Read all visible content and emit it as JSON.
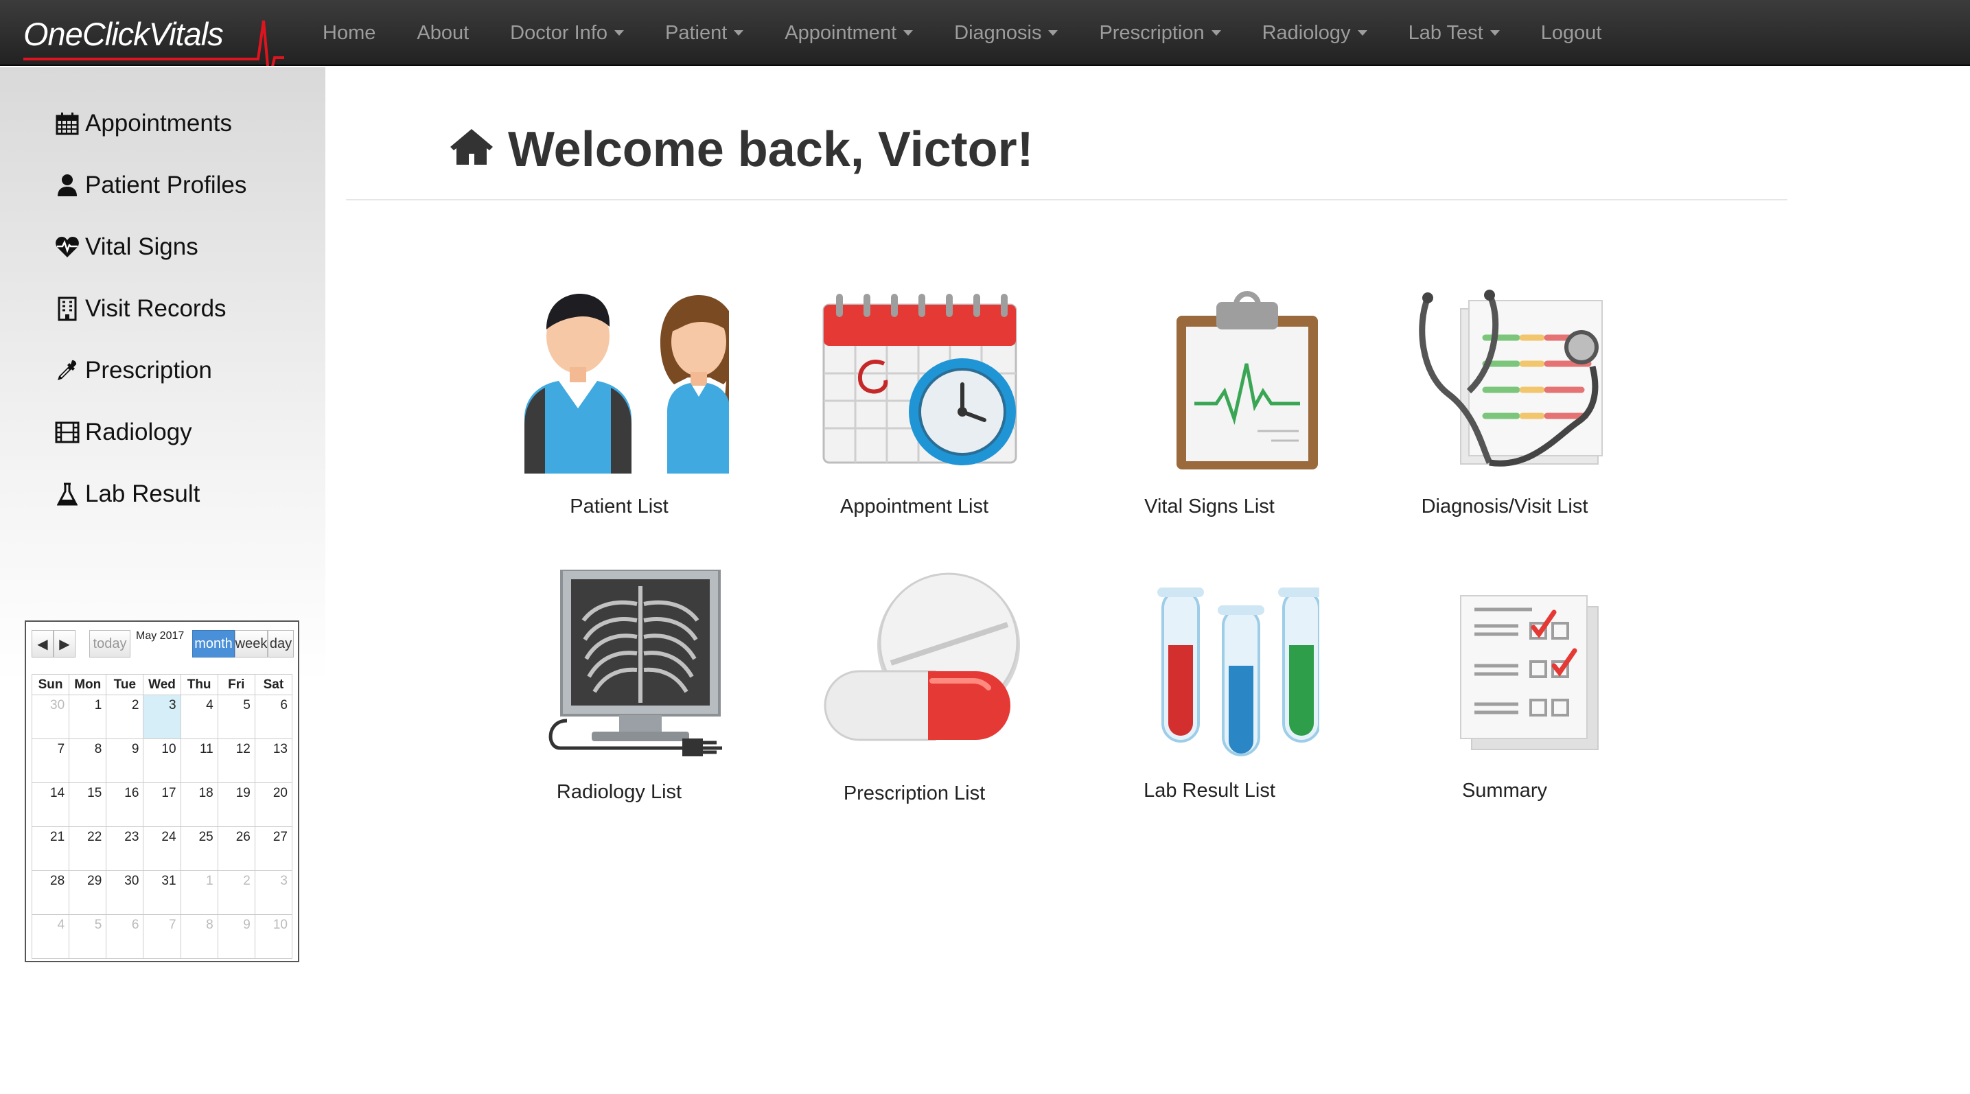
{
  "brand": {
    "name": "OneClickVitals"
  },
  "nav": [
    {
      "label": "Home",
      "dropdown": false
    },
    {
      "label": "About",
      "dropdown": false
    },
    {
      "label": "Doctor Info",
      "dropdown": true
    },
    {
      "label": "Patient",
      "dropdown": true
    },
    {
      "label": "Appointment",
      "dropdown": true
    },
    {
      "label": "Diagnosis",
      "dropdown": true
    },
    {
      "label": "Prescription",
      "dropdown": true
    },
    {
      "label": "Radiology",
      "dropdown": true
    },
    {
      "label": "Lab Test",
      "dropdown": true
    },
    {
      "label": "Logout",
      "dropdown": false
    }
  ],
  "sidebar": {
    "items": [
      {
        "label": "Appointments",
        "icon": "calendar-icon"
      },
      {
        "label": "Patient Profiles",
        "icon": "user-icon"
      },
      {
        "label": "Vital Signs",
        "icon": "heartbeat-icon"
      },
      {
        "label": "Visit Records",
        "icon": "building-icon"
      },
      {
        "label": "Prescription",
        "icon": "eyedropper-icon"
      },
      {
        "label": "Radiology",
        "icon": "film-icon"
      },
      {
        "label": "Lab Result",
        "icon": "flask-icon"
      }
    ]
  },
  "calendar": {
    "prev": "◀",
    "next": "▶",
    "today": "today",
    "title": "May 2017",
    "views": [
      "month",
      "week",
      "day"
    ],
    "active_view": "month",
    "weekdays": [
      "Sun",
      "Mon",
      "Tue",
      "Wed",
      "Thu",
      "Fri",
      "Sat"
    ],
    "weeks": [
      [
        "30",
        "1",
        "2",
        "3",
        "4",
        "5",
        "6"
      ],
      [
        "7",
        "8",
        "9",
        "10",
        "11",
        "12",
        "13"
      ],
      [
        "14",
        "15",
        "16",
        "17",
        "18",
        "19",
        "20"
      ],
      [
        "21",
        "22",
        "23",
        "24",
        "25",
        "26",
        "27"
      ],
      [
        "28",
        "29",
        "30",
        "31",
        "1",
        "2",
        "3"
      ],
      [
        "4",
        "5",
        "6",
        "7",
        "8",
        "9",
        "10"
      ]
    ],
    "today_date": "3"
  },
  "main": {
    "welcome": "Welcome back, Victor!",
    "tiles": [
      {
        "label": "Patient List",
        "icon": "patients-icon"
      },
      {
        "label": "Appointment List",
        "icon": "calendar-clock-icon"
      },
      {
        "label": "Vital Signs List",
        "icon": "clipboard-vitals-icon"
      },
      {
        "label": "Diagnosis/Visit List",
        "icon": "stethoscope-icon"
      },
      {
        "label": "Radiology List",
        "icon": "xray-monitor-icon"
      },
      {
        "label": "Prescription List",
        "icon": "pills-icon"
      },
      {
        "label": "Lab Result List",
        "icon": "test-tubes-icon"
      },
      {
        "label": "Summary",
        "icon": "checklist-icon"
      }
    ]
  },
  "colors": {
    "navbar": "#222222",
    "accent_red": "#e53935",
    "active_view": "#4a90d9"
  }
}
